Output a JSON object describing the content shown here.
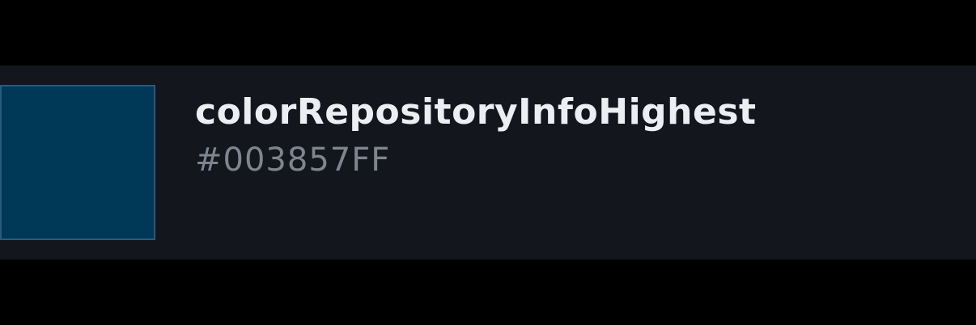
{
  "token": {
    "name": "colorRepositoryInfoHighest",
    "hex": "#003857FF",
    "swatch_color": "#003857",
    "swatch_border_color": "#2a5a7e"
  },
  "colors": {
    "page_background": "#000000",
    "card_background": "#13161c",
    "name_text": "#eceef2",
    "hex_text": "#7f8590"
  }
}
